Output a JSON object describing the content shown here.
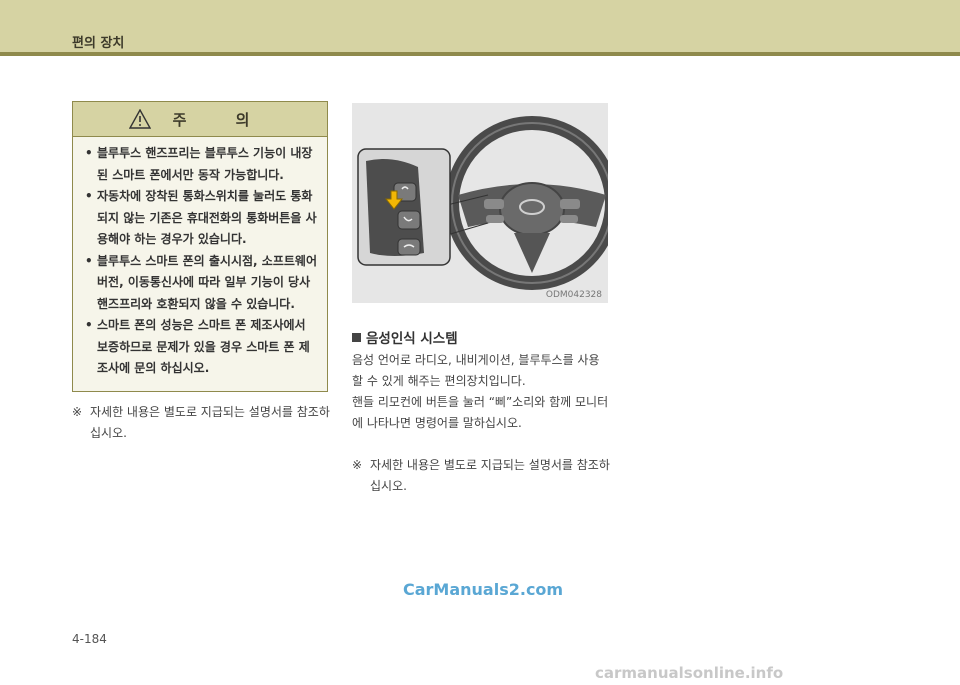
{
  "header": {
    "section_title": "편의 장치"
  },
  "caution": {
    "title": "주  의",
    "items": [
      "블루투스 핸즈프리는 블루투스 기능이 내장된 스마트 폰에서만 동작 가능합니다.",
      "자동차에 장착된 통화스위치를 눌러도 통화 되지 않는 기존은 휴대전화의 통화버튼을 사용해야 하는 경우가 있습니다.",
      "블루투스 스마트 폰의 출시시점, 소프트웨어 버전, 이동통신사에 따라 일부 기능이 당사 핸즈프리와 호환되지 않을 수 있습니다.",
      "스마트 폰의 성능은 스마트 폰 제조사에서 보증하므로 문제가 있을 경우 스마트 폰 제조사에 문의 하십시오."
    ],
    "bullet": "•"
  },
  "left_note": {
    "mark": "※",
    "text": "자세한 내용은 별도로 지급되는 설명서를 참조하십시오."
  },
  "figure": {
    "code": "ODM042328"
  },
  "section": {
    "title": "음성인식 시스템",
    "paragraph1": "음성 언어로 라디오, 내비게이션, 블루투스를 사용할 수 있게 해주는 편의장치입니다.",
    "paragraph2": "핸들 리모컨에 버튼을 눌러 “삐”소리와 함께 모니터에 나타나면 명령어를 말하십시오."
  },
  "right_note": {
    "mark": "※",
    "text": "자세한 내용은 별도로 지급되는 설명서를 참조하십시오."
  },
  "watermark": "CarManuals2.com",
  "page_number": "4-184",
  "footer_watermark": "carmanualsonline.info"
}
